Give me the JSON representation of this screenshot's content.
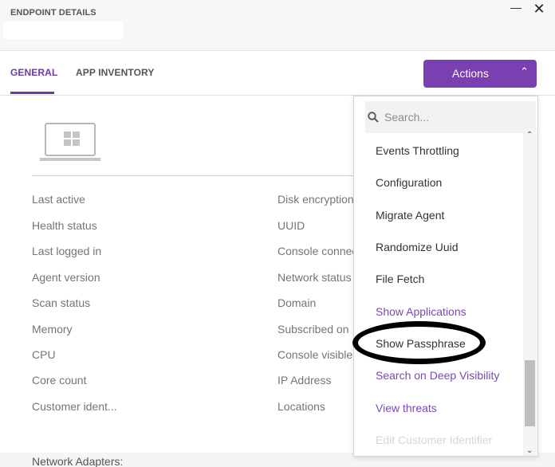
{
  "header": {
    "title": "ENDPOINT DETAILS",
    "minimize_glyph": "—",
    "close_glyph": "✕"
  },
  "tabs": [
    {
      "label": "GENERAL",
      "active": true
    },
    {
      "label": "APP INVENTORY",
      "active": false
    }
  ],
  "actions": {
    "label": "Actions",
    "chevron": "⌃"
  },
  "device": {
    "icon": "windows-laptop-icon"
  },
  "details_left": [
    "Last active",
    "Health status",
    "Last logged in",
    "Agent version",
    "Scan status",
    "Memory",
    "CPU",
    "Core count",
    "Customer ident..."
  ],
  "details_right": [
    "Disk encryption",
    "UUID",
    "Console connec",
    "Network status",
    "Domain",
    "Subscribed on",
    "Console visible",
    "IP Address",
    "Locations"
  ],
  "network_adapters_label": "Network Adapters:",
  "dropdown": {
    "search_placeholder": "Search...",
    "items": [
      {
        "label": "Events Throttling",
        "style": "normal"
      },
      {
        "label": "Configuration",
        "style": "normal"
      },
      {
        "label": "Migrate Agent",
        "style": "normal"
      },
      {
        "label": "Randomize Uuid",
        "style": "normal"
      },
      {
        "label": "File Fetch",
        "style": "normal"
      },
      {
        "label": "Show Applications",
        "style": "purple"
      },
      {
        "label": "Show Passphrase",
        "style": "normal"
      },
      {
        "label": "Search on Deep Visibility",
        "style": "purple"
      },
      {
        "label": "View threats",
        "style": "purple"
      },
      {
        "label": "Edit Customer Identifier",
        "style": "disabled"
      }
    ]
  },
  "scroll": {
    "up_glyph": "⌃",
    "down_glyph": "⌄",
    "position": 0.72
  },
  "colors": {
    "accent": "#7a3fb0",
    "accent_text": "#6a3aa5",
    "link": "#7a4bb0",
    "disabled": "#d6d6d6"
  }
}
